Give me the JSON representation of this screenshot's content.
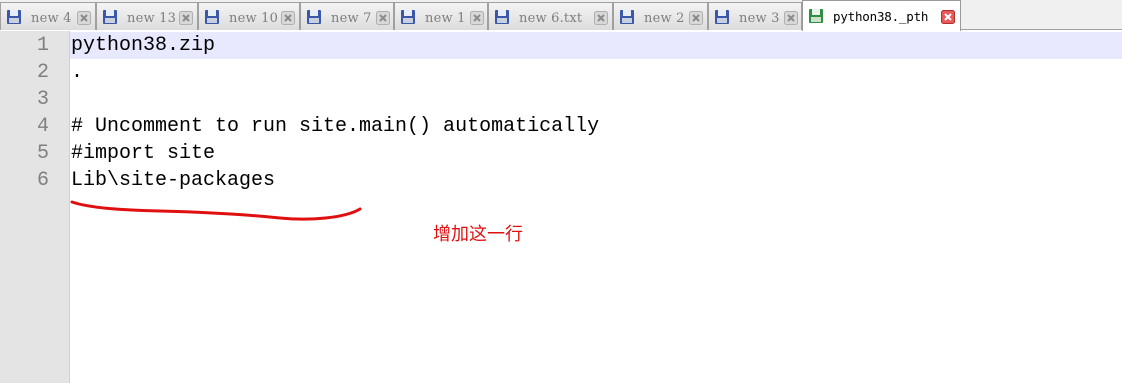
{
  "tabs": [
    {
      "label": "new 4",
      "active": false
    },
    {
      "label": "new 13",
      "active": false
    },
    {
      "label": "new 10",
      "active": false
    },
    {
      "label": "new 7",
      "active": false
    },
    {
      "label": "new 1",
      "active": false
    },
    {
      "label": "new 6.txt",
      "active": false
    },
    {
      "label": "new 2",
      "active": false
    },
    {
      "label": "new 3",
      "active": false
    },
    {
      "label": "python38._pth",
      "active": true
    }
  ],
  "editor": {
    "line_numbers": [
      "1",
      "2",
      "3",
      "4",
      "5",
      "6"
    ],
    "lines": [
      "python38.zip",
      ".",
      "",
      "# Uncomment to run site.main() automatically",
      "#import site",
      "Lib\\site-packages"
    ],
    "current_line": 1
  },
  "annotation": {
    "text": "增加这一行",
    "color": "#e01010"
  },
  "colors": {
    "current_line_bg": "#e8e8ff",
    "gutter_bg": "#e4e4e4",
    "close_icon": "#c03030",
    "save_icon_blue": "#3b58a8",
    "save_icon_green": "#2f8f3f"
  }
}
